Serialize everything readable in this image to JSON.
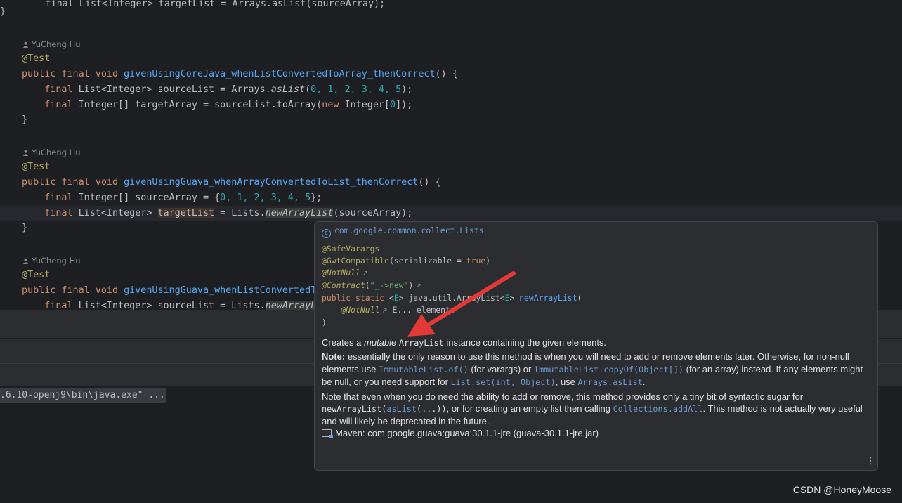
{
  "editor": {
    "authors": [
      "YuCheng Hu",
      "YuCheng Hu",
      "YuCheng Hu"
    ],
    "lines": {
      "l0": "        final List<Integer> targetList = Arrays.asList(sourceArray);",
      "brace1": "}",
      "annot": "@Test",
      "kw_pfv": "public final void ",
      "m1_name": "givenUsingCoreJava_whenListConvertedToArray_thenCorrect",
      "m1_tail": "() {",
      "m1_l1_a": "    final ",
      "m1_l1_b": "List<Integer> sourceList = Arrays.",
      "m1_l1_c": "asList",
      "m1_l1_d": "(",
      "m1_l1_e": "0, 1, 2, 3, 4, 5",
      "m1_l1_f": ");",
      "m1_l2_a": "    final ",
      "m1_l2_b": "Integer[] targetArray = sourceList.toArray(",
      "m1_l2_c": "new ",
      "m1_l2_d": "Integer[",
      "m1_l2_e": "0",
      "m1_l2_f": "]);",
      "m2_name": "givenUsingGuava_whenArrayConvertedToList_thenCorrect",
      "m2_tail": "() {",
      "m2_l1_a": "    final ",
      "m2_l1_b": "Integer[] sourceArray = {",
      "m2_l1_c": "0, 1, 2, 3, 4, 5",
      "m2_l1_d": "};",
      "m2_l2_a": "    final ",
      "m2_l2_b": "List<Integer> ",
      "m2_l2_c": "targetList",
      "m2_l2_d": " = Lists.",
      "m2_l2_e": "newArrayList",
      "m2_l2_f": "(sourceArray);",
      "m3_name": "givenUsingGuava_whenListConvertedT",
      "m3_l1_a": "    final ",
      "m3_l1_b": "List<Integer> sourceList = Lists.",
      "m3_l1_c": "newArrayLi"
    }
  },
  "console": {
    "command": ".6.10-openj9\\bin\\java.exe\" ..."
  },
  "popup": {
    "owner": "com.google.common.collect.Lists",
    "badge": "c",
    "sig": {
      "a1": "@SafeVarargs",
      "a2a": "@GwtCompatible",
      "a2b": "(serializable = ",
      "a2c": "true",
      "a2d": ")",
      "a3": "@NotNull",
      "a4a": "@Contract",
      "a4b": "(",
      "a4c": "\"_->new\"",
      "a4d": ")",
      "d1": "public static ",
      "d2": "<",
      "d3": "E",
      "d4": "> java.util.ArrayList<",
      "d5": "E",
      "d6": "> ",
      "d7": "newArrayList",
      "d8": "(",
      "p1": "    ",
      "p2": "@NotNull",
      "p3": " E... elements",
      "close": ")"
    },
    "doc": {
      "p1a": "Creates a ",
      "p1b": "mutable",
      "p1c": "ArrayList",
      "p1d": " instance containing the given elements.",
      "note_label": "Note:",
      "p2a": " essentially the only reason to use this method is when you will need to add or remove elements later. Otherwise, for non-null elements use ",
      "p2b": "ImmutableList.of()",
      "p2c": " (for varargs) or ",
      "p2d": "ImmutableList.copyOf(Object[])",
      "p2e": " (for an array) instead. If any elements might be null, or you need support for ",
      "p2f": "List.set(int, Object)",
      "p2g": ", use ",
      "p2h": "Arrays.asList",
      "p2i": ".",
      "p3a": "Note that even when you do need the ability to add or remove, this method provides only a tiny bit of syntactic sugar for ",
      "p3b": "newArrayList(",
      "p3c": "asList",
      "p3d": "(...))",
      "p3e": ", or for creating an empty list then calling ",
      "p3f": "Collections.addAll",
      "p3g": ". This method is not actually very useful and will likely be deprecated in the future."
    },
    "maven": "Maven: com.google.guava:guava:30.1.1-jre (guava-30.1.1-jre.jar)",
    "ext_glyph": "↗",
    "more_glyph": "⋮"
  },
  "watermark": "CSDN @HoneyMoose",
  "colors": {
    "keyword": "#cf8e6d",
    "annotation": "#b3ae60",
    "method": "#56a8f5",
    "number": "#2aacb8",
    "link": "#6d9ed8",
    "arrow": "#e53935"
  }
}
